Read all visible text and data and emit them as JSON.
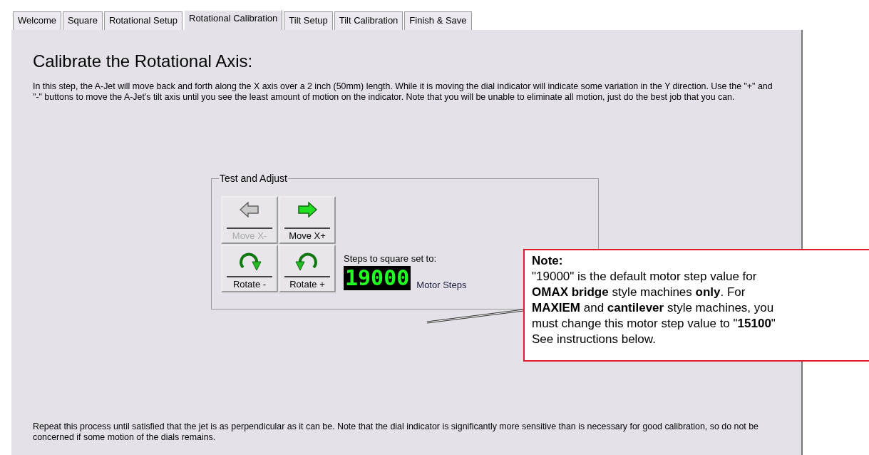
{
  "tabs": [
    {
      "label": "Welcome",
      "selected": false
    },
    {
      "label": "Square",
      "selected": false
    },
    {
      "label": "Rotational Setup",
      "selected": false
    },
    {
      "label": "Rotational Calibration",
      "selected": true
    },
    {
      "label": "Tilt Setup",
      "selected": false
    },
    {
      "label": "Tilt Calibration",
      "selected": false
    },
    {
      "label": "Finish & Save",
      "selected": false
    }
  ],
  "heading": "Calibrate the Rotational Axis:",
  "intro": "In this step, the A-Jet will move back and forth along the X axis over a 2 inch (50mm) length.  While it is moving the dial indicator will indicate some variation in the Y direction.  Use the \"+\" and \"-\" buttons to move the A-Jet's tilt axis until you see the least amount of motion on the indicator.  Note that you will be unable to eliminate all motion, just do the best job that you can.",
  "group": {
    "title": "Test and Adjust",
    "buttons": [
      {
        "label": "Move X-",
        "kind": "left",
        "disabled": true
      },
      {
        "label": "Move X+",
        "kind": "right",
        "disabled": false
      },
      {
        "label": "Rotate -",
        "kind": "cw",
        "disabled": false
      },
      {
        "label": "Rotate +",
        "kind": "ccw",
        "disabled": false
      }
    ],
    "steps_label": "Steps to square set to:",
    "steps_value": "19000",
    "steps_unit": "Motor Steps"
  },
  "note": {
    "title": "Note:",
    "lines": [
      "\"19000\" is the default motor step value for",
      "**OMAX bridge** style machines **only**. For",
      "**MAXIEM** and **cantilever** style machines, you",
      "must change this motor step value to \"**15100**\"",
      "See instructions below."
    ]
  },
  "footer": "Repeat this process until satisfied that the jet is as perpendicular as it can be.  Note that the dial indicator is significantly more sensitive than is necessary for good calibration, so do not be concerned if some motion of the dials remains."
}
